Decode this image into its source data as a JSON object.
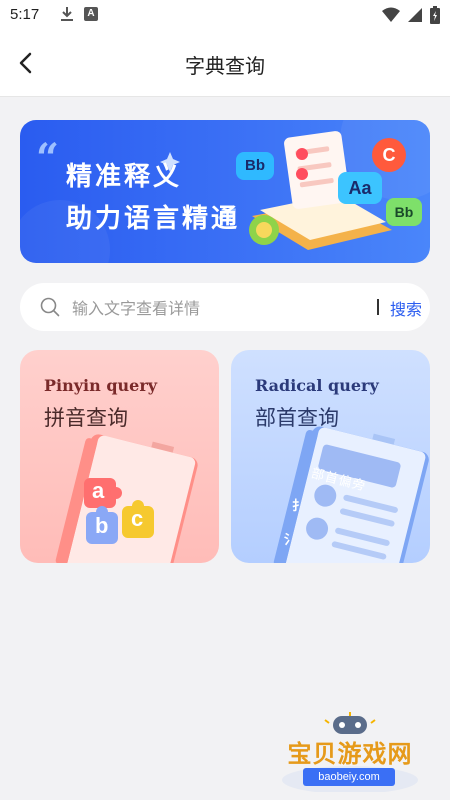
{
  "status_bar": {
    "time": "5:17"
  },
  "header": {
    "title": "字典查询"
  },
  "banner": {
    "line1": "精准释义",
    "line2": "助力语言精通",
    "badges": [
      "Bb",
      "Aa",
      "C",
      "Bb"
    ]
  },
  "search": {
    "placeholder": "输入文字查看详情",
    "button_label": "搜索"
  },
  "cards": [
    {
      "en": "Pinyin query",
      "zh": "拼音查询",
      "letters": [
        "a",
        "b",
        "c"
      ]
    },
    {
      "en": "Radical query",
      "zh": "部首查询",
      "book_label": "部首偏旁",
      "radicals": [
        "扌",
        "氵"
      ]
    }
  ],
  "watermark": {
    "text": "宝贝游戏网",
    "url": "baobeiy.com"
  },
  "colors": {
    "accent": "#2a5cf0",
    "pinyin_card": "#ffc4c0",
    "radical_card": "#c4d8ff"
  }
}
